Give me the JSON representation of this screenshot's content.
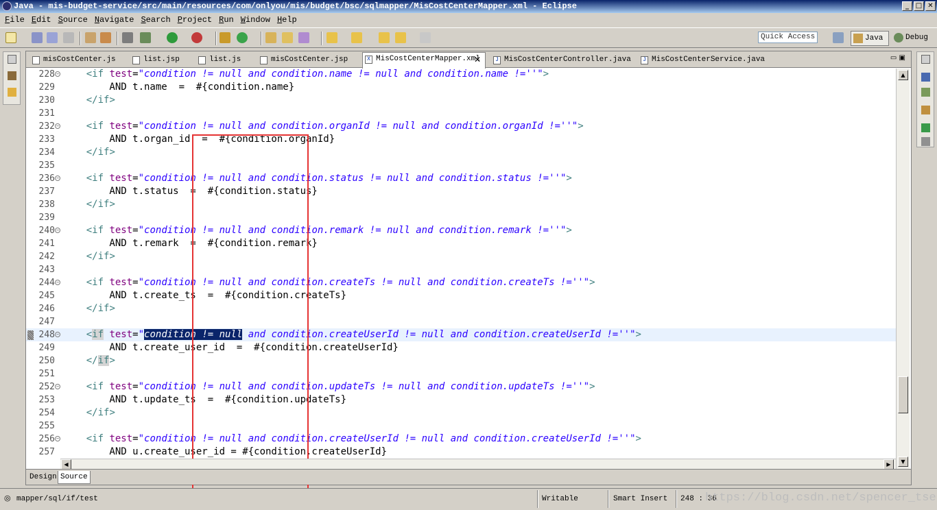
{
  "window": {
    "title": "Java - mis-budget-service/src/main/resources/com/onlyou/mis/budget/bsc/sqlmapper/MisCostCenterMapper.xml - Eclipse",
    "minimize": "_",
    "maximize": "□",
    "close": "✕"
  },
  "menu": [
    "File",
    "Edit",
    "Source",
    "Navigate",
    "Search",
    "Project",
    "Run",
    "Window",
    "Help"
  ],
  "toolbar": {
    "quick_access_placeholder": "Quick Access"
  },
  "perspectives": {
    "java": "Java",
    "debug": "Debug"
  },
  "tabs": [
    {
      "label": "misCostCenter.js",
      "icon": "js-file-icon",
      "active": false
    },
    {
      "label": "list.jsp",
      "icon": "jsp-file-icon",
      "active": false
    },
    {
      "label": "list.js",
      "icon": "js-file-icon",
      "active": false
    },
    {
      "label": "misCostCenter.jsp",
      "icon": "jsp-file-icon",
      "active": false
    },
    {
      "label": "MisCostCenterMapper.xml",
      "icon": "xml-file-icon",
      "active": true
    },
    {
      "label": "MisCostCenterController.java",
      "icon": "java-file-icon",
      "active": false
    },
    {
      "label": "MisCostCenterService.java",
      "icon": "java-file-icon",
      "active": false
    }
  ],
  "code_lines": [
    {
      "n": "228",
      "kind": "if",
      "field": "name"
    },
    {
      "n": "229",
      "kind": "and",
      "text": "        AND t.name  =  #{condition.name}"
    },
    {
      "n": "230",
      "kind": "endif"
    },
    {
      "n": "231",
      "kind": "blank"
    },
    {
      "n": "232",
      "kind": "if",
      "field": "organId"
    },
    {
      "n": "233",
      "kind": "and",
      "text": "        AND t.organ_id  =  #{condition.organId}"
    },
    {
      "n": "234",
      "kind": "endif"
    },
    {
      "n": "235",
      "kind": "blank"
    },
    {
      "n": "236",
      "kind": "if",
      "field": "status"
    },
    {
      "n": "237",
      "kind": "and",
      "text": "        AND t.status  =  #{condition.status}"
    },
    {
      "n": "238",
      "kind": "endif"
    },
    {
      "n": "239",
      "kind": "blank"
    },
    {
      "n": "240",
      "kind": "if",
      "field": "remark"
    },
    {
      "n": "241",
      "kind": "and",
      "text": "        AND t.remark  =  #{condition.remark}"
    },
    {
      "n": "242",
      "kind": "endif"
    },
    {
      "n": "243",
      "kind": "blank"
    },
    {
      "n": "244",
      "kind": "if",
      "field": "createTs"
    },
    {
      "n": "245",
      "kind": "and",
      "text": "        AND t.create_ts  =  #{condition.createTs}"
    },
    {
      "n": "246",
      "kind": "endif"
    },
    {
      "n": "247",
      "kind": "blank"
    },
    {
      "n": "248",
      "kind": "if",
      "field": "createUserId",
      "current": true
    },
    {
      "n": "249",
      "kind": "and",
      "text": "        AND t.create_user_id  =  #{condition.createUserId}"
    },
    {
      "n": "250",
      "kind": "endif",
      "current_pair": true
    },
    {
      "n": "251",
      "kind": "blank"
    },
    {
      "n": "252",
      "kind": "if",
      "field": "updateTs"
    },
    {
      "n": "253",
      "kind": "and",
      "text": "        AND t.update_ts  =  #{condition.updateTs}"
    },
    {
      "n": "254",
      "kind": "endif"
    },
    {
      "n": "255",
      "kind": "blank"
    },
    {
      "n": "256",
      "kind": "if",
      "field": "createUserId"
    },
    {
      "n": "257",
      "kind": "and",
      "text": "        AND u.create_user_id = #{condition.createUserId}"
    }
  ],
  "bottom_tabs": {
    "design": "Design",
    "source": "Source"
  },
  "status": {
    "path": "mapper/sql/if/test",
    "writable": "Writable",
    "insert_mode": "Smart Insert",
    "position": "248 : 36",
    "watermark": "https://blog.csdn.net/spencer_tseng"
  }
}
